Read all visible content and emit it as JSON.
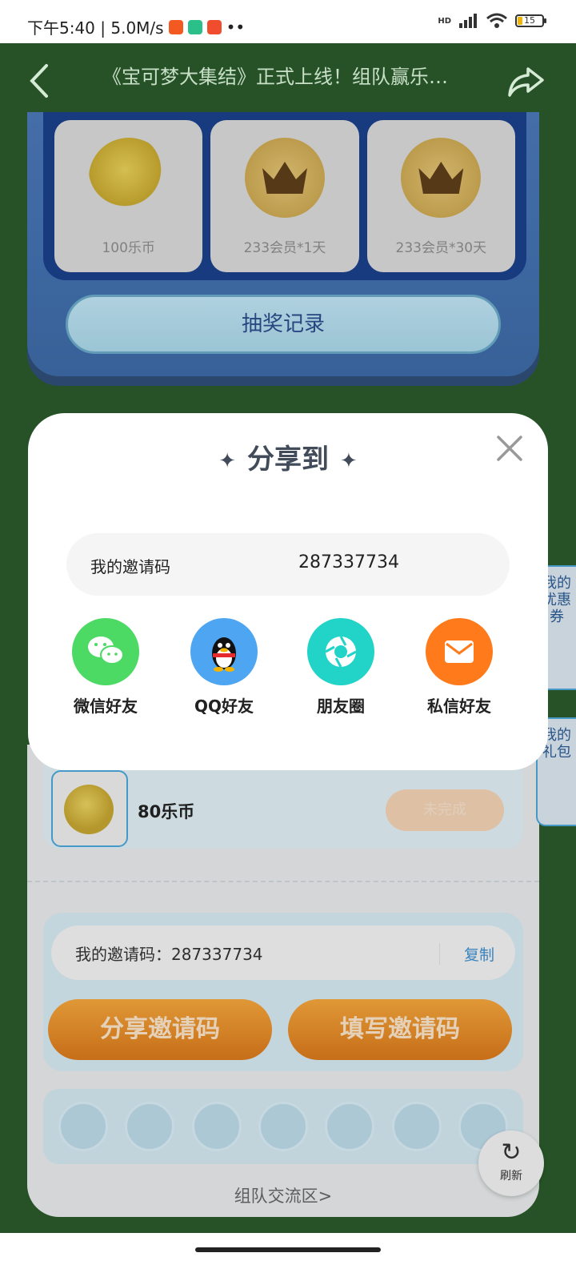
{
  "status_bar": {
    "time_speed": "下午5:40 | 5.0M/s",
    "dots": "••",
    "battery": "15",
    "network": "HD"
  },
  "header": {
    "title": "《宝可梦大集结》正式上线！组队赢乐…"
  },
  "prizes": [
    {
      "label": "100乐币",
      "icon": "coin-stack"
    },
    {
      "label": "233会员*1天",
      "icon": "crown"
    },
    {
      "label": "233会员*30天",
      "icon": "crown"
    }
  ],
  "record_button": "抽奖记录",
  "task": {
    "reward": "80乐币",
    "status": "未完成"
  },
  "invite": {
    "text": "我的邀请码：287337734",
    "copy": "复制",
    "share_btn": "分享邀请码",
    "fill_btn": "填写邀请码"
  },
  "forum_link": "组队交流区>",
  "side_tabs": {
    "coupons": "我的优惠券",
    "gifts": "我的礼包"
  },
  "refresh_label": "刷新",
  "modal": {
    "title": "分享到",
    "code_label": "我的邀请码",
    "code_value": "287337734",
    "targets": [
      {
        "label": "微信好友",
        "icon": "wechat-icon",
        "color": "#4cd964"
      },
      {
        "label": "QQ好友",
        "icon": "qq-icon",
        "color": "#4ea6f2"
      },
      {
        "label": "朋友圈",
        "icon": "moments-icon",
        "color": "#22d3c8"
      },
      {
        "label": "私信好友",
        "icon": "mail-icon",
        "color": "#ff7a1a"
      }
    ]
  }
}
